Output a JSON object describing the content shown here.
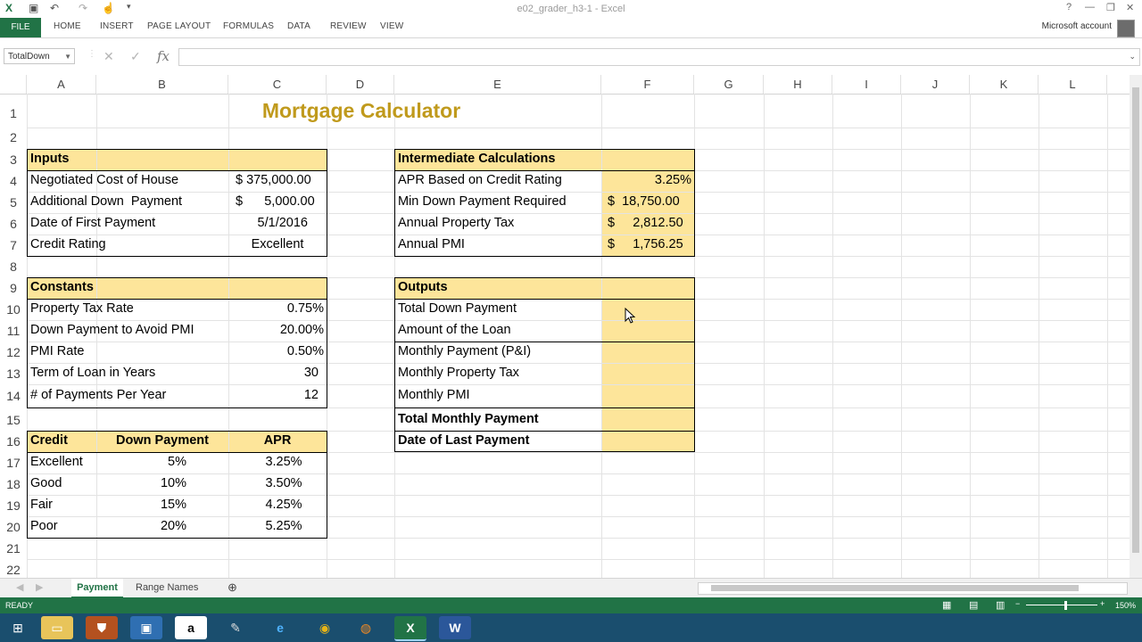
{
  "window": {
    "title": "e02_grader_h3-1 - Excel"
  },
  "ribbon": {
    "file": "FILE",
    "tabs": [
      "HOME",
      "INSERT",
      "PAGE LAYOUT",
      "FORMULAS",
      "DATA",
      "REVIEW",
      "VIEW"
    ],
    "account": "Microsoft account"
  },
  "formula_bar": {
    "name_box": "TotalDown",
    "fx": "fx",
    "formula": ""
  },
  "columns": [
    "A",
    "B",
    "C",
    "D",
    "E",
    "F",
    "G",
    "H",
    "I",
    "J",
    "K",
    "L"
  ],
  "rows": [
    "1",
    "2",
    "3",
    "4",
    "5",
    "6",
    "7",
    "8",
    "9",
    "10",
    "11",
    "12",
    "13",
    "14",
    "15",
    "16",
    "17",
    "18",
    "19",
    "20",
    "21",
    "22"
  ],
  "sheet": {
    "title": "Mortgage Calculator",
    "inputs": {
      "header": "Inputs",
      "rows": [
        {
          "label": "Negotiated Cost of House",
          "value": "$ 375,000.00"
        },
        {
          "label": "Additional Down  Payment",
          "value": "$      5,000.00"
        },
        {
          "label": "Date of First Payment",
          "value": "5/1/2016"
        },
        {
          "label": "Credit Rating",
          "value": "Excellent"
        }
      ]
    },
    "constants": {
      "header": "Constants",
      "rows": [
        {
          "label": "Property Tax Rate",
          "value": "0.75%"
        },
        {
          "label": "Down Payment to Avoid PMI",
          "value": "20.00%"
        },
        {
          "label": "PMI Rate",
          "value": "0.50%"
        },
        {
          "label": "Term of Loan in Years",
          "value": "30"
        },
        {
          "label": "# of Payments Per Year",
          "value": "12"
        }
      ]
    },
    "rates": {
      "headers": [
        "Credit",
        "Down Payment",
        "APR"
      ],
      "rows": [
        [
          "Excellent",
          "5%",
          "3.25%"
        ],
        [
          "Good",
          "10%",
          "3.50%"
        ],
        [
          "Fair",
          "15%",
          "4.25%"
        ],
        [
          "Poor",
          "20%",
          "5.25%"
        ]
      ]
    },
    "intermediate": {
      "header": "Intermediate Calculations",
      "rows": [
        {
          "label": "APR Based on Credit Rating",
          "value": "3.25%"
        },
        {
          "label": "Min Down Payment Required",
          "value": "$  18,750.00"
        },
        {
          "label": "Annual Property Tax",
          "value": "$     2,812.50"
        },
        {
          "label": "Annual PMI",
          "value": "$     1,756.25"
        }
      ]
    },
    "outputs": {
      "header": "Outputs",
      "rows": [
        "Total Down Payment",
        "Amount of the Loan",
        "Monthly Payment (P&I)",
        "Monthly Property Tax",
        "Monthly PMI",
        "Total Monthly Payment",
        "Date of Last Payment"
      ]
    }
  },
  "sheet_tabs": [
    "Payment",
    "Range Names"
  ],
  "status": {
    "ready": "READY",
    "zoom": "150%"
  },
  "colors": {
    "accent": "#217346",
    "fill": "#fde59a",
    "title": "#c09a1c"
  }
}
